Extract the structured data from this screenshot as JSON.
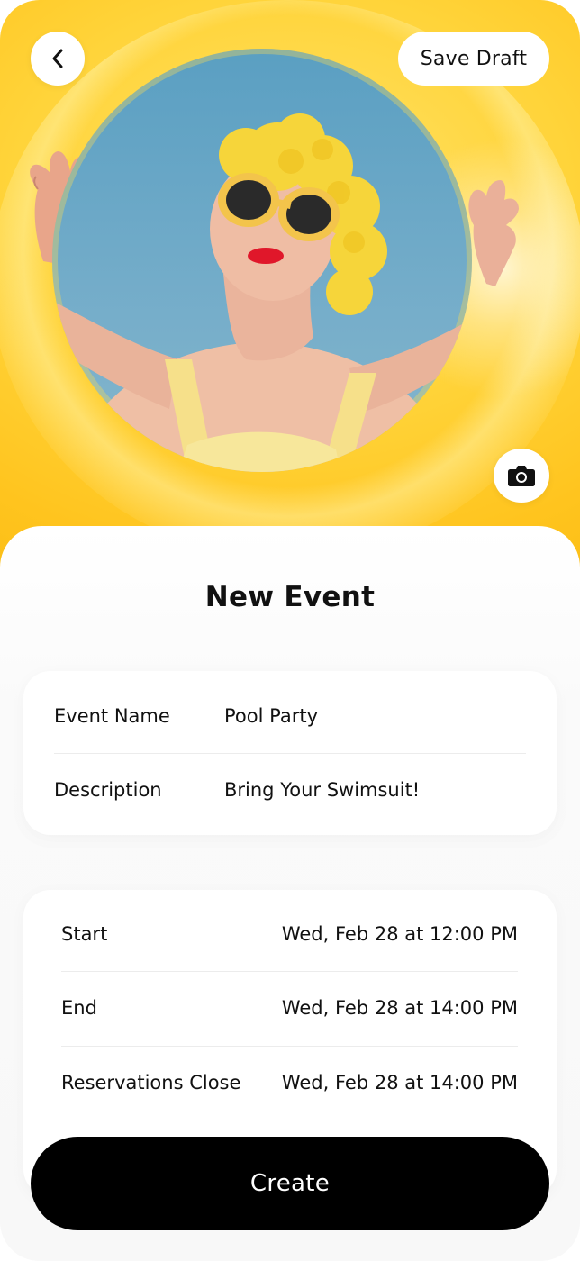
{
  "header": {
    "save_draft_label": "Save Draft"
  },
  "icons": {
    "back": "chevron-left-icon",
    "camera": "camera-icon"
  },
  "colors": {
    "hero_yellow": "#ffd43a",
    "primary_button": "#000000",
    "primary_button_text": "#ffffff"
  },
  "page": {
    "title": "New Event"
  },
  "details": {
    "event_name_label": "Event Name",
    "event_name_value": "Pool Party",
    "description_label": "Description",
    "description_value": "Bring Your Swimsuit!"
  },
  "schedule": {
    "start_label": "Start",
    "start_value": "Wed, Feb 28 at 12:00 PM",
    "end_label": "End",
    "end_value": "Wed, Feb 28 at 14:00 PM",
    "reservations_label": "Reservations Close",
    "reservations_value": "Wed, Feb 28 at 14:00 PM"
  },
  "actions": {
    "create_label": "Create"
  }
}
